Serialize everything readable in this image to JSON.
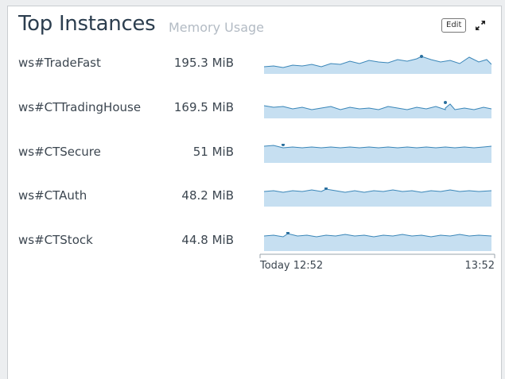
{
  "widget": {
    "title": "Top Instances",
    "subtitle": "Memory Usage",
    "edit_label": "Edit",
    "expand_icon": "expand-icon"
  },
  "rows": [
    {
      "name": "ws#TradeFast",
      "value": "195.3 MiB"
    },
    {
      "name": "ws#CTTradingHouse",
      "value": "169.5 MiB"
    },
    {
      "name": "ws#CTSecure",
      "value": "51 MiB"
    },
    {
      "name": "ws#CTAuth",
      "value": "48.2 MiB"
    },
    {
      "name": "ws#CTStock",
      "value": "44.8 MiB"
    }
  ],
  "axis": {
    "start_label": "Today 12:52",
    "end_label": "13:52"
  },
  "colors": {
    "spark_fill": "#c6dff1",
    "spark_line": "#3a86b8",
    "title": "#2c3e4f",
    "subtitle": "#b3bbc4"
  }
}
